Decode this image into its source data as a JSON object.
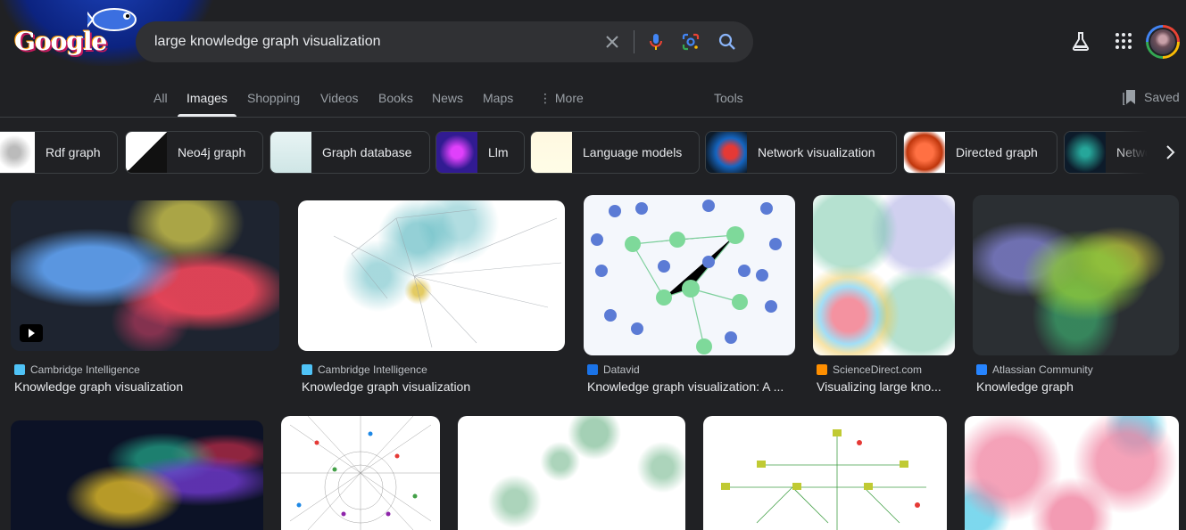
{
  "search": {
    "query": "large knowledge graph visualization"
  },
  "doodle": {
    "logo_text": "Google"
  },
  "tabs": [
    {
      "label": "All"
    },
    {
      "label": "Images"
    },
    {
      "label": "Shopping"
    },
    {
      "label": "Videos"
    },
    {
      "label": "Books"
    },
    {
      "label": "News"
    },
    {
      "label": "Maps"
    },
    {
      "label": "More"
    },
    {
      "label": "Tools"
    }
  ],
  "saved_label": "Saved",
  "chips": [
    {
      "label": "Rdf graph"
    },
    {
      "label": "Neo4j graph"
    },
    {
      "label": "Graph database"
    },
    {
      "label": "Llm"
    },
    {
      "label": "Language models"
    },
    {
      "label": "Network visualization"
    },
    {
      "label": "Directed graph"
    },
    {
      "label": "Netwo"
    }
  ],
  "results": [
    {
      "source": "Cambridge Intelligence",
      "title": "Knowledge graph visualization",
      "favicon_color": "#4fc3f7",
      "has_video": true
    },
    {
      "source": "Cambridge Intelligence",
      "title": "Knowledge graph visualization",
      "favicon_color": "#4fc3f7",
      "has_video": false
    },
    {
      "source": "Datavid",
      "title": "Knowledge graph visualization: A ...",
      "favicon_color": "#1a73e8",
      "has_video": false
    },
    {
      "source": "ScienceDirect.com",
      "title": "Visualizing large kno...",
      "favicon_color": "#ff8f00",
      "has_video": false
    },
    {
      "source": "Atlassian Community",
      "title": "Knowledge graph",
      "favicon_color": "#2684ff",
      "has_video": false
    }
  ],
  "colors": {
    "accent": "#8ab4f8",
    "background": "#202124",
    "search_bg": "#303134"
  }
}
